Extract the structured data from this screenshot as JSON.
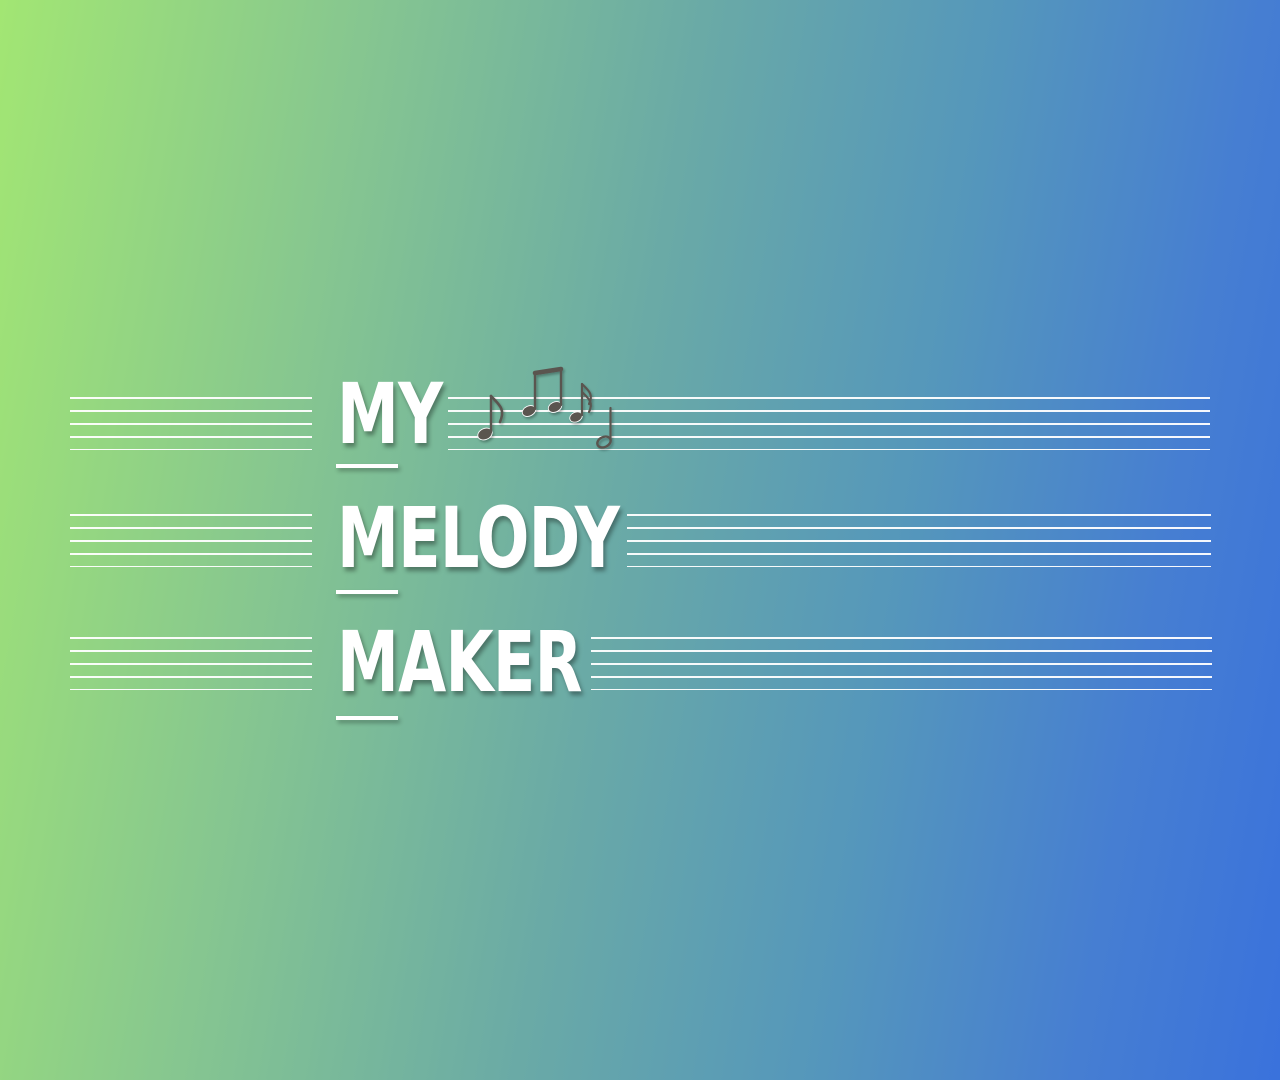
{
  "title": {
    "line1": "MY",
    "line2": "MELODY",
    "line3": "MAKER"
  },
  "icons": {
    "notes": "music-notes-icon"
  },
  "colors": {
    "gradient_start": "#a2e673",
    "gradient_end": "#3a72dc",
    "text": "#ffffff",
    "note": "#5a5450"
  }
}
